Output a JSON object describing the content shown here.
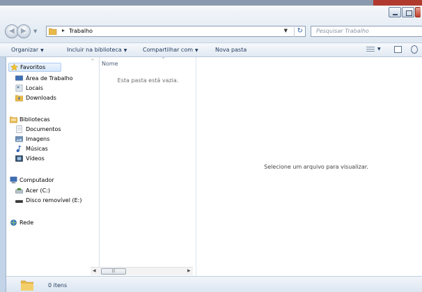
{
  "address": {
    "path": [
      "Trabalho"
    ],
    "search_placeholder": "Pesquisar Trabalho"
  },
  "toolbar": {
    "organize": "Organizar",
    "include_library": "Incluir na biblioteca",
    "share_with": "Compartilhar com",
    "new_folder": "Nova pasta"
  },
  "sidebar": {
    "favorites": {
      "label": "Favoritos",
      "items": [
        "Área de Trabalho",
        "Locais",
        "Downloads"
      ]
    },
    "libraries": {
      "label": "Bibliotecas",
      "items": [
        "Documentos",
        "Imagens",
        "Músicas",
        "Vídeos"
      ]
    },
    "computer": {
      "label": "Computador",
      "items": [
        "Acer (C:)",
        "Disco removível (E:)"
      ]
    },
    "network": {
      "label": "Rede"
    }
  },
  "file_list": {
    "column_name": "Nome",
    "empty_message": "Esta pasta está vazia."
  },
  "preview": {
    "message": "Selecione um arquivo para visualizar."
  },
  "details": {
    "item_count": "0 itens"
  },
  "colors": {
    "folder": "#e8b94a",
    "accent_blue": "#2f64b0"
  }
}
